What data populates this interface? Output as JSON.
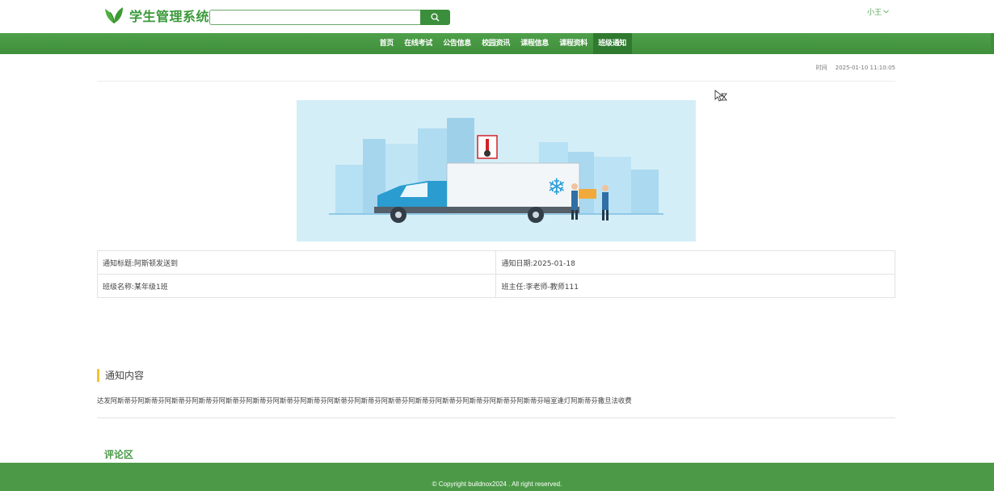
{
  "app": {
    "title": "学生管理系统"
  },
  "search": {
    "placeholder": ""
  },
  "user": {
    "name": "小王"
  },
  "nav": {
    "items": [
      {
        "label": "首页",
        "active": false
      },
      {
        "label": "在线考试",
        "active": false
      },
      {
        "label": "公告信息",
        "active": false
      },
      {
        "label": "校园资讯",
        "active": false
      },
      {
        "label": "课程信息",
        "active": false
      },
      {
        "label": "课程资料",
        "active": false
      },
      {
        "label": "班级通知",
        "active": true
      }
    ]
  },
  "detail": {
    "time_label": "时间",
    "time_value": "2025-01-10 11:10:05",
    "notice_title": "通知标题:阿斯顿发送到",
    "notice_date": "通知日期:2025-01-18",
    "class_name": "班级名称:某年级1班",
    "head_teacher": "班主任:李老师-教师111"
  },
  "content": {
    "heading": "通知内容",
    "body": "达发阿斯蒂芬阿斯蒂芬阿斯蒂芬阿斯蒂芬阿斯蒂芬阿斯蒂芬阿斯蒂芬阿斯蒂芬阿斯蒂芬阿斯蒂芬阿斯蒂芬阿斯蒂芬阿斯蒂芬阿斯蒂芬阿斯蒂芬阿斯蒂芬暗室逢灯阿斯蒂芬撒旦法收费"
  },
  "comments": {
    "heading": "评论区"
  },
  "footer": {
    "copyright": "© Copyright buildnox2024 . All right reserved."
  },
  "colors": {
    "brand_green": "#3e8e3b",
    "accent_yellow": "#f4c430",
    "banner_bg": "#d4eef7"
  },
  "icons": {
    "logo": "leaf-icon",
    "search": "search-icon",
    "user_menu": "chevron-down-icon",
    "cursor": "cursor-icon"
  }
}
